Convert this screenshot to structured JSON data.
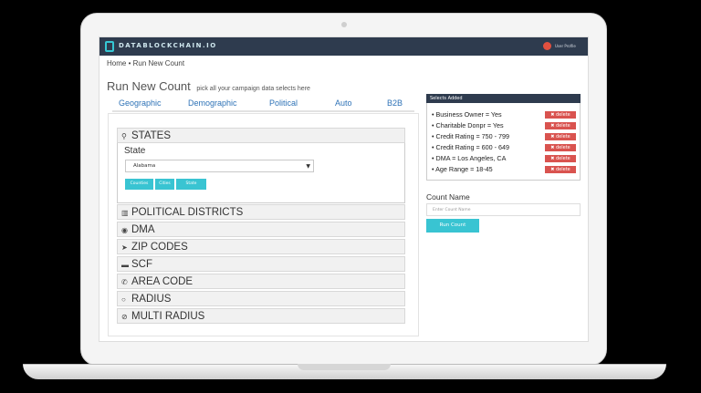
{
  "app": {
    "logo_text": "DATABLOCKCHAIN.IO",
    "user_label": "User Profile"
  },
  "breadcrumb": "Home • Run New Count",
  "page": {
    "title": "Run New Count",
    "subtitle": "pick all your campaign data selects here"
  },
  "tabs": [
    "Geographic",
    "Demographic",
    "Political",
    "Auto",
    "B2B"
  ],
  "accordion": {
    "states": {
      "title": "STATES",
      "icon": "map-pin-icon"
    },
    "political": {
      "title": "POLITICAL DISTRICTS",
      "icon": "map-icon"
    },
    "dma": {
      "title": "DMA",
      "icon": "dot-circle-icon"
    },
    "zip": {
      "title": "ZIP CODES",
      "icon": "send-icon"
    },
    "scf": {
      "title": "SCF",
      "icon": "card-icon"
    },
    "area": {
      "title": "AREA CODE",
      "icon": "phone-icon"
    },
    "radius": {
      "title": "RADIUS",
      "icon": "circle-icon"
    },
    "multi": {
      "title": "MULTI RADIUS",
      "icon": "check-circle-icon"
    }
  },
  "state_panel": {
    "label": "State",
    "selected": "Alabama",
    "buttons": [
      "Counties",
      "Cities",
      "State"
    ]
  },
  "selects": {
    "header": "Selects Added",
    "items": [
      "Business Owner = Yes",
      "Charitable Donpr = Yes",
      "Credit Rating = 750 - 799",
      "Credit Rating = 600 - 649",
      "DMA = Los Angeles, CA",
      "Age Range = 18-45"
    ],
    "delete_label": "delete"
  },
  "count": {
    "label": "Count Name",
    "placeholder": "Enter Count Name",
    "button": "Run Count"
  },
  "colors": {
    "accent": "#39c4d2",
    "header_dark": "#2e3b4e",
    "delete_red": "#d9534f",
    "tab_blue": "#2f73b7"
  }
}
